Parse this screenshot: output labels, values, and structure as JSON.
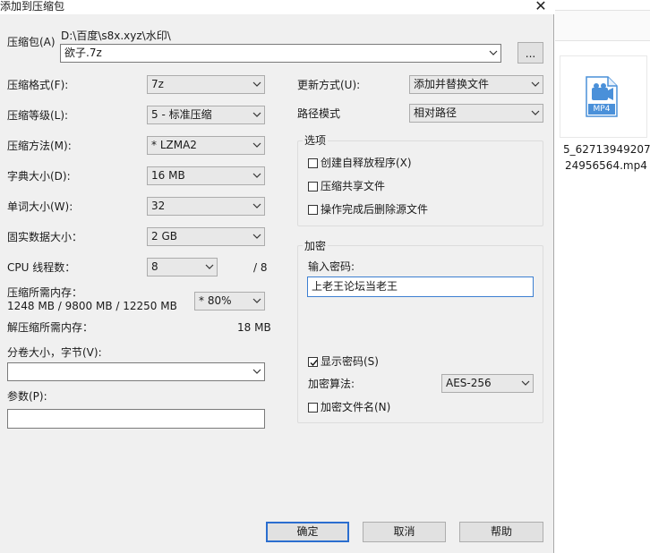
{
  "dialog": {
    "title": "添加到压缩包",
    "archive_label": "压缩包(A)",
    "archive_path": "D:\\百度\\s8x.xyz\\水印\\",
    "archive_name": "欲子.7z",
    "browse_label": "..."
  },
  "left": {
    "format_label": "压缩格式(F):",
    "format_value": "7z",
    "level_label": "压缩等级(L):",
    "level_value": "5 - 标准压缩",
    "method_label": "压缩方法(M):",
    "method_value": "* LZMA2",
    "dict_label": "字典大小(D):",
    "dict_value": "16 MB",
    "word_label": "单词大小(W):",
    "word_value": "32",
    "solid_label": "固实数据大小：",
    "solid_value": "2 GB",
    "threads_label": "CPU 线程数：",
    "threads_value": "8",
    "threads_total": "/ 8",
    "mem_comp_label": "压缩所需内存：",
    "mem_comp_value": "1248 MB / 9800 MB / 12250 MB",
    "mem_percent": "* 80%",
    "mem_decomp_label": "解压缩所需内存：",
    "mem_decomp_value": "18 MB",
    "split_label": "分卷大小，字节(V):",
    "split_value": "",
    "params_label": "参数(P):",
    "params_value": ""
  },
  "right": {
    "update_label": "更新方式(U):",
    "update_value": "添加并替换文件",
    "path_label": "路径模式",
    "path_value": "相对路径",
    "options_title": "选项",
    "opt_sfx": "创建自释放程序(X)",
    "opt_shared": "压缩共享文件",
    "opt_delete": "操作完成后删除源文件",
    "encrypt_title": "加密",
    "password_label": "输入密码:",
    "password_value": "上老王论坛当老王",
    "show_password": "显示密码(S)",
    "show_password_checked": true,
    "enc_method_label": "加密算法:",
    "enc_method_value": "AES-256",
    "encrypt_names": "加密文件名(N)"
  },
  "buttons": {
    "ok": "确定",
    "cancel": "取消",
    "help": "帮助"
  },
  "background": {
    "file_badge": "MP4",
    "file_name_line1": "5_62713949207",
    "file_name_line2": "24956564.mp4"
  }
}
